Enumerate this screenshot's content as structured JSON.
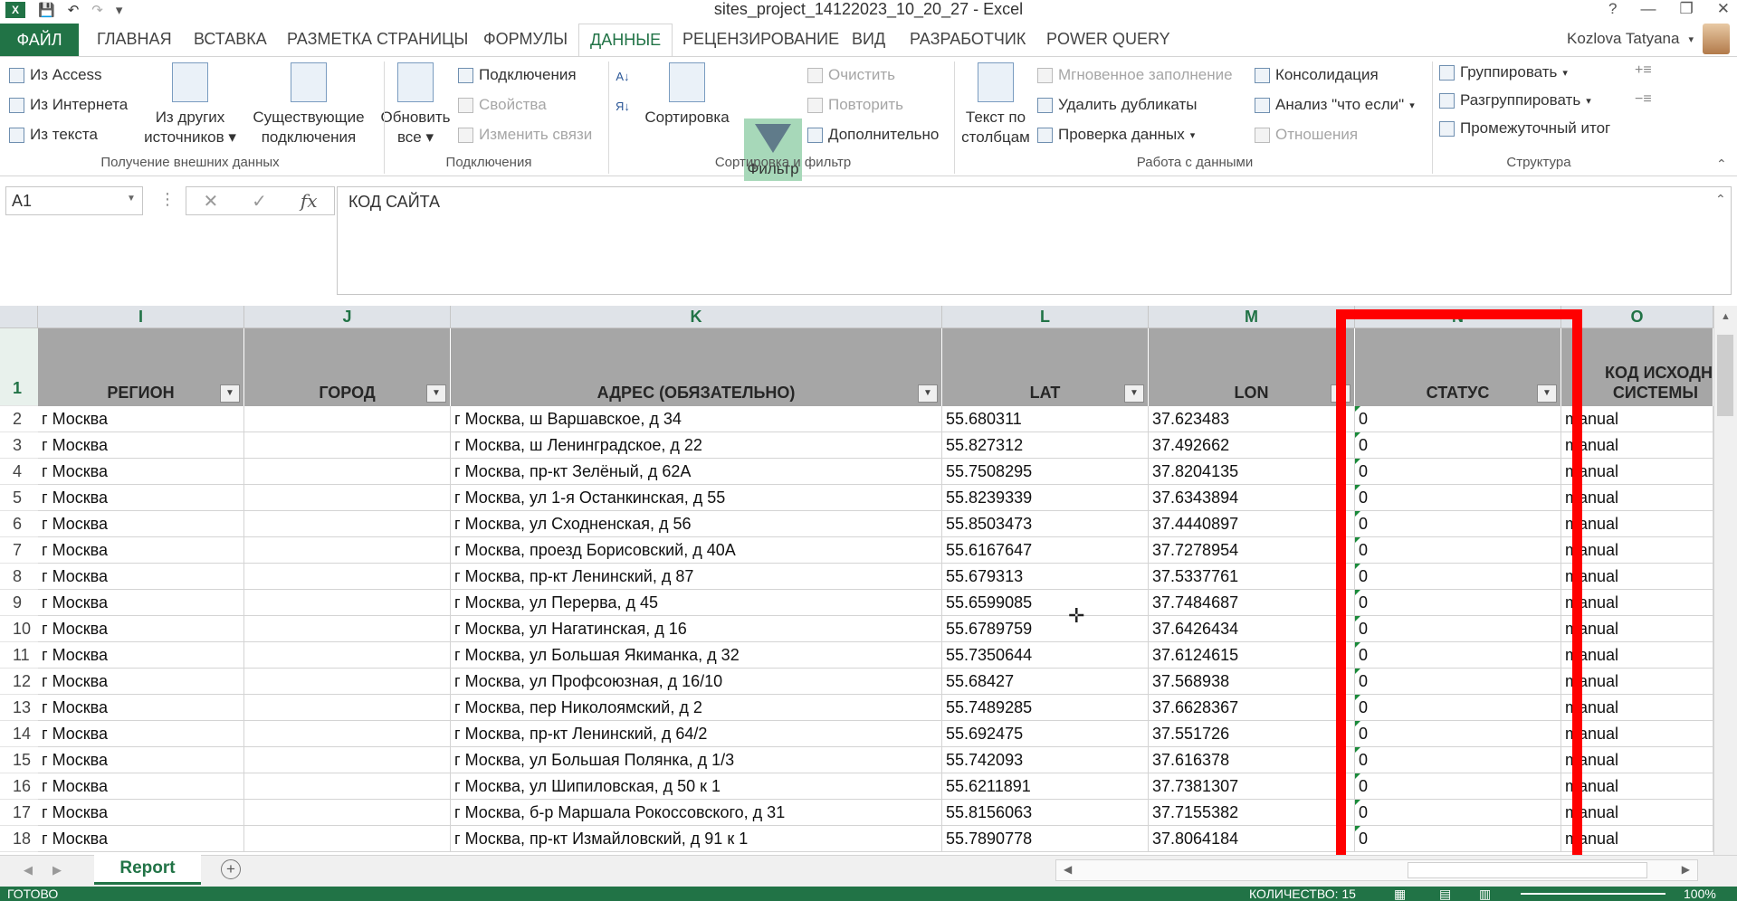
{
  "window": {
    "title": "sites_project_14122023_10_20_27 - Excel",
    "help": "?",
    "minimize": "—",
    "restore": "❐",
    "close": "✕",
    "logo": "X"
  },
  "qat": {
    "save": "💾",
    "undo": "↶",
    "redo": "↷",
    "more": "▾"
  },
  "tabs": {
    "file": "ФАЙЛ",
    "home": "ГЛАВНАЯ",
    "insert": "ВСТАВКА",
    "layout": "РАЗМЕТКА СТРАНИЦЫ",
    "formulas": "ФОРМУЛЫ",
    "data": "ДАННЫЕ",
    "review": "РЕЦЕНЗИРОВАНИЕ",
    "view": "ВИД",
    "developer": "РАЗРАБОТЧИК",
    "powerquery": "POWER QUERY"
  },
  "user": {
    "name": "Kozlova Tatyana"
  },
  "ribbon": {
    "ext": {
      "access": "Из Access",
      "web": "Из Интернета",
      "text": "Из текста",
      "other_1": "Из других",
      "other_2": "источников",
      "existing_1": "Существующие",
      "existing_2": "подключения",
      "group": "Получение внешних данных"
    },
    "conn": {
      "refresh_1": "Обновить",
      "refresh_2": "все",
      "connections": "Подключения",
      "properties": "Свойства",
      "edit_links": "Изменить связи",
      "group": "Подключения"
    },
    "sort": {
      "sort": "Сортировка",
      "filter": "Фильтр",
      "clear": "Очистить",
      "reapply": "Повторить",
      "advanced": "Дополнительно",
      "group": "Сортировка и фильтр"
    },
    "tools": {
      "text_cols_1": "Текст по",
      "text_cols_2": "столбцам",
      "flash_fill": "Мгновенное заполнение",
      "remove_dup": "Удалить дубликаты",
      "validation": "Проверка данных",
      "consolidate": "Консолидация",
      "whatif": "Анализ \"что если\"",
      "relations": "Отношения",
      "group": "Работа с данными"
    },
    "outline": {
      "group_btn": "Группировать",
      "ungroup": "Разгруппировать",
      "subtotal": "Промежуточный итог",
      "group": "Структура"
    }
  },
  "formula_bar": {
    "name_box": "A1",
    "content": "КОД САЙТА",
    "fx": "fx",
    "cancel": "✕",
    "enter": "✓"
  },
  "columns": [
    {
      "letter": "I",
      "header": "РЕГИОН"
    },
    {
      "letter": "J",
      "header": "ГОРОД"
    },
    {
      "letter": "K",
      "header": "АДРЕС (ОБЯЗАТЕЛЬНО)"
    },
    {
      "letter": "L",
      "header": "LAT"
    },
    {
      "letter": "M",
      "header": "LON"
    },
    {
      "letter": "N",
      "header": "СТАТУС"
    },
    {
      "letter": "O",
      "header_1": "КОД ИСХОДН",
      "header_2": "СИСТЕМЫ"
    }
  ],
  "rows": [
    {
      "n": "2",
      "region": "г Москва",
      "city": "",
      "address": "г Москва, ш Варшавское, д 34",
      "lat": "55.680311",
      "lon": "37.623483",
      "status": "0",
      "source": "manual"
    },
    {
      "n": "3",
      "region": "г Москва",
      "city": "",
      "address": "г Москва, ш Ленинградское, д 22",
      "lat": "55.827312",
      "lon": "37.492662",
      "status": "0",
      "source": "manual"
    },
    {
      "n": "4",
      "region": "г Москва",
      "city": "",
      "address": "г Москва, пр-кт Зелёный, д 62А",
      "lat": "55.7508295",
      "lon": "37.8204135",
      "status": "0",
      "source": "manual"
    },
    {
      "n": "5",
      "region": "г Москва",
      "city": "",
      "address": "г Москва, ул 1-я Останкинская, д 55",
      "lat": "55.8239339",
      "lon": "37.6343894",
      "status": "0",
      "source": "manual"
    },
    {
      "n": "6",
      "region": "г Москва",
      "city": "",
      "address": "г Москва, ул Сходненская, д 56",
      "lat": "55.8503473",
      "lon": "37.4440897",
      "status": "0",
      "source": "manual"
    },
    {
      "n": "7",
      "region": "г Москва",
      "city": "",
      "address": "г Москва, проезд Борисовский, д 40А",
      "lat": "55.6167647",
      "lon": "37.7278954",
      "status": "0",
      "source": "manual"
    },
    {
      "n": "8",
      "region": "г Москва",
      "city": "",
      "address": "г Москва, пр-кт Ленинский, д 87",
      "lat": "55.679313",
      "lon": "37.5337761",
      "status": "0",
      "source": "manual"
    },
    {
      "n": "9",
      "region": "г Москва",
      "city": "",
      "address": "г Москва, ул Перерва, д 45",
      "lat": "55.6599085",
      "lon": "37.7484687",
      "status": "0",
      "source": "manual"
    },
    {
      "n": "10",
      "region": "г Москва",
      "city": "",
      "address": "г Москва, ул Нагатинская, д 16",
      "lat": "55.6789759",
      "lon": "37.6426434",
      "status": "0",
      "source": "manual"
    },
    {
      "n": "11",
      "region": "г Москва",
      "city": "",
      "address": "г Москва, ул Большая Якиманка, д 32",
      "lat": "55.7350644",
      "lon": "37.6124615",
      "status": "0",
      "source": "manual"
    },
    {
      "n": "12",
      "region": "г Москва",
      "city": "",
      "address": "г Москва, ул Профсоюзная, д 16/10",
      "lat": "55.68427",
      "lon": "37.568938",
      "status": "0",
      "source": "manual"
    },
    {
      "n": "13",
      "region": "г Москва",
      "city": "",
      "address": "г Москва, пер Николоямский, д 2",
      "lat": "55.7489285",
      "lon": "37.6628367",
      "status": "0",
      "source": "manual"
    },
    {
      "n": "14",
      "region": "г Москва",
      "city": "",
      "address": "г Москва, пр-кт Ленинский, д 64/2",
      "lat": "55.692475",
      "lon": "37.551726",
      "status": "0",
      "source": "manual"
    },
    {
      "n": "15",
      "region": "г Москва",
      "city": "",
      "address": "г Москва, ул Большая Полянка, д 1/3",
      "lat": "55.742093",
      "lon": "37.616378",
      "status": "0",
      "source": "manual"
    },
    {
      "n": "16",
      "region": "г Москва",
      "city": "",
      "address": "г Москва, ул Шипиловская, д 50 к 1",
      "lat": "55.6211891",
      "lon": "37.7381307",
      "status": "0",
      "source": "manual"
    },
    {
      "n": "17",
      "region": "г Москва",
      "city": "",
      "address": "г Москва, б-р Маршала Рокоссовского, д 31",
      "lat": "55.8156063",
      "lon": "37.7155382",
      "status": "0",
      "source": "manual"
    },
    {
      "n": "18",
      "region": "г Москва",
      "city": "",
      "address": "г Москва, пр-кт Измайловский, д 91 к 1",
      "lat": "55.7890778",
      "lon": "37.8064184",
      "status": "0",
      "source": "manual"
    }
  ],
  "header_row_num": "1",
  "sheets": [
    {
      "name": "Report"
    }
  ],
  "add_sheet": "+",
  "status": {
    "ready": "ГОТОВО",
    "count": "КОЛИЧЕСТВО: 15",
    "zoom": "100%"
  },
  "colors": {
    "accent": "#217346",
    "highlight": "#ff0000",
    "header_fill": "#a6a6a6"
  }
}
